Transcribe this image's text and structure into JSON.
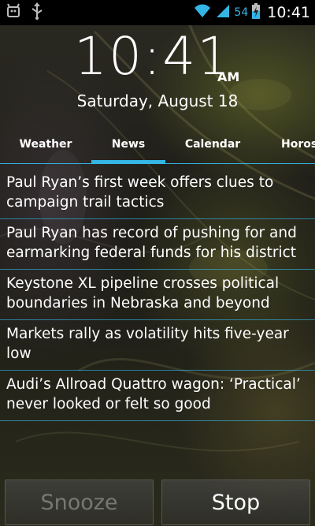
{
  "status_bar": {
    "battery_percent": "54",
    "time": "10:41",
    "icons": [
      "android-debug-icon",
      "usb-icon",
      "wifi-icon",
      "signal-icon",
      "battery-charging-icon"
    ]
  },
  "clock": {
    "time": "10:41",
    "ampm": "AM",
    "date": "Saturday, August 18"
  },
  "tabs": {
    "weather": "Weather",
    "news": "News",
    "calendar": "Calendar",
    "horoscope": "Horos",
    "active": "News"
  },
  "news": [
    "Paul Ryan’s first week offers clues to campaign trail tactics",
    "Paul Ryan has record of pushing for and earmarking federal funds for his district",
    "Keystone XL pipeline crosses political boundaries in Nebraska and beyond",
    "Markets rally as volatility hits five-year low",
    "Audi’s Allroad Quattro wagon: ‘Practical’ never looked or felt so good"
  ],
  "buttons": {
    "snooze": "Snooze",
    "stop": "Stop"
  },
  "colors": {
    "accent": "#33b5e5",
    "status_bar_bg": "#000000"
  }
}
